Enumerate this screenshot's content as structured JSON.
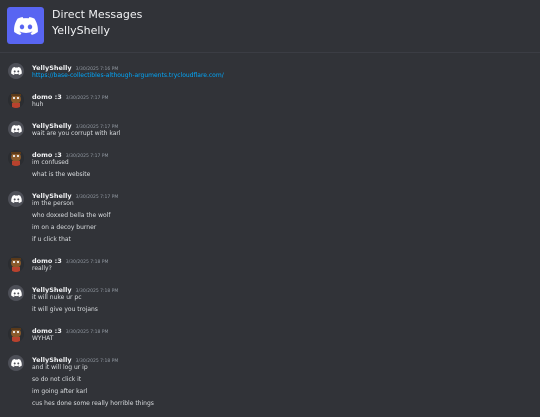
{
  "header": {
    "title": "Direct Messages",
    "subtitle": "YellyShelly",
    "logo_icon": "discord-logo-icon",
    "logo_color": "#5865f2"
  },
  "messages": [
    {
      "author": "YellyShelly",
      "time": "3/30/2025 7:16 PM",
      "avatar": "discord-default-avatar-icon",
      "lines": [
        "https://base-collectibles-although-arguments.trycloudflare.com/"
      ],
      "link": true
    },
    {
      "author": "domo :3",
      "time": "3/30/2025 7:17 PM",
      "avatar": "user-avatar-icon",
      "lines": [
        "huh"
      ]
    },
    {
      "author": "YellyShelly",
      "time": "3/30/2025 7:17 PM",
      "avatar": "discord-default-avatar-icon",
      "lines": [
        "wait are you corrupt with karl"
      ]
    },
    {
      "author": "domo :3",
      "time": "3/30/2025 7:17 PM",
      "avatar": "user-avatar-icon",
      "lines": [
        "im confused",
        "what is the website"
      ]
    },
    {
      "author": "YellyShelly",
      "time": "3/30/2025 7:17 PM",
      "avatar": "discord-default-avatar-icon",
      "lines": [
        "im the person",
        "who doxxed bella the wolf",
        "im on a decoy burner",
        "if u click that"
      ]
    },
    {
      "author": "domo :3",
      "time": "3/30/2025 7:18 PM",
      "avatar": "user-avatar-icon",
      "lines": [
        "really?"
      ]
    },
    {
      "author": "YellyShelly",
      "time": "3/30/2025 7:18 PM",
      "avatar": "discord-default-avatar-icon",
      "lines": [
        "it will nuke ur pc",
        "it will give you trojans"
      ]
    },
    {
      "author": "domo :3",
      "time": "3/30/2025 7:18 PM",
      "avatar": "user-avatar-icon",
      "lines": [
        "WYHAT"
      ]
    },
    {
      "author": "YellyShelly",
      "time": "3/30/2025 7:18 PM",
      "avatar": "discord-default-avatar-icon",
      "lines": [
        "and it will log ur ip",
        "so do not click it",
        "im going after karl",
        "cus hes done some really horrible things"
      ]
    }
  ]
}
